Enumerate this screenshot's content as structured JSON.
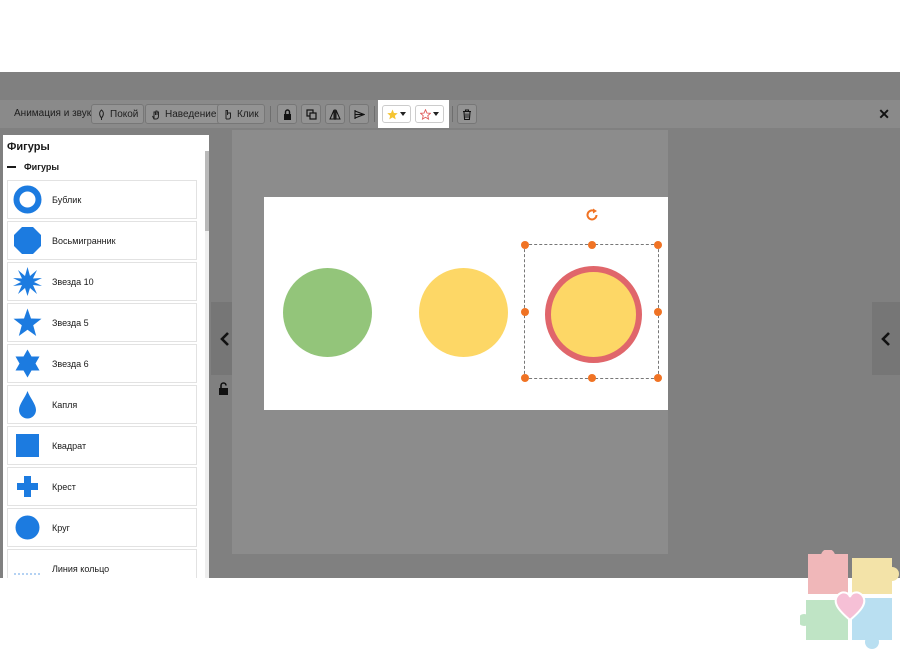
{
  "toolbar": {
    "animation_label": "Анимация и звук",
    "rest_label": "Покой",
    "hover_label": "Наведение",
    "click_label": "Клик",
    "fill_star_color": "#f5c431",
    "stroke_star_color": "#e05a5a"
  },
  "panel": {
    "title": "Фигуры",
    "group_label": "Фигуры",
    "icon_color": "#1c7be0",
    "items": [
      {
        "label": "Бублик",
        "icon": "ring-icon"
      },
      {
        "label": "Восьмигранник",
        "icon": "octagon-icon"
      },
      {
        "label": "Звезда 10",
        "icon": "star10-icon"
      },
      {
        "label": "Звезда 5",
        "icon": "star5-icon"
      },
      {
        "label": "Звезда 6",
        "icon": "star6-icon"
      },
      {
        "label": "Капля",
        "icon": "drop-icon"
      },
      {
        "label": "Квадрат",
        "icon": "square-icon"
      },
      {
        "label": "Крест",
        "icon": "cross-icon"
      },
      {
        "label": "Круг",
        "icon": "circle-icon"
      },
      {
        "label": "Линия кольцо",
        "icon": "dotted-line-icon"
      }
    ]
  },
  "canvas": {
    "shapes": [
      {
        "name": "green-circle",
        "fill": "#93c57a"
      },
      {
        "name": "yellow-circle",
        "fill": "#fdd766"
      },
      {
        "name": "selected-circle",
        "fill": "#fdd766",
        "stroke": "#e0666b"
      }
    ],
    "handle_color": "#f07324"
  }
}
